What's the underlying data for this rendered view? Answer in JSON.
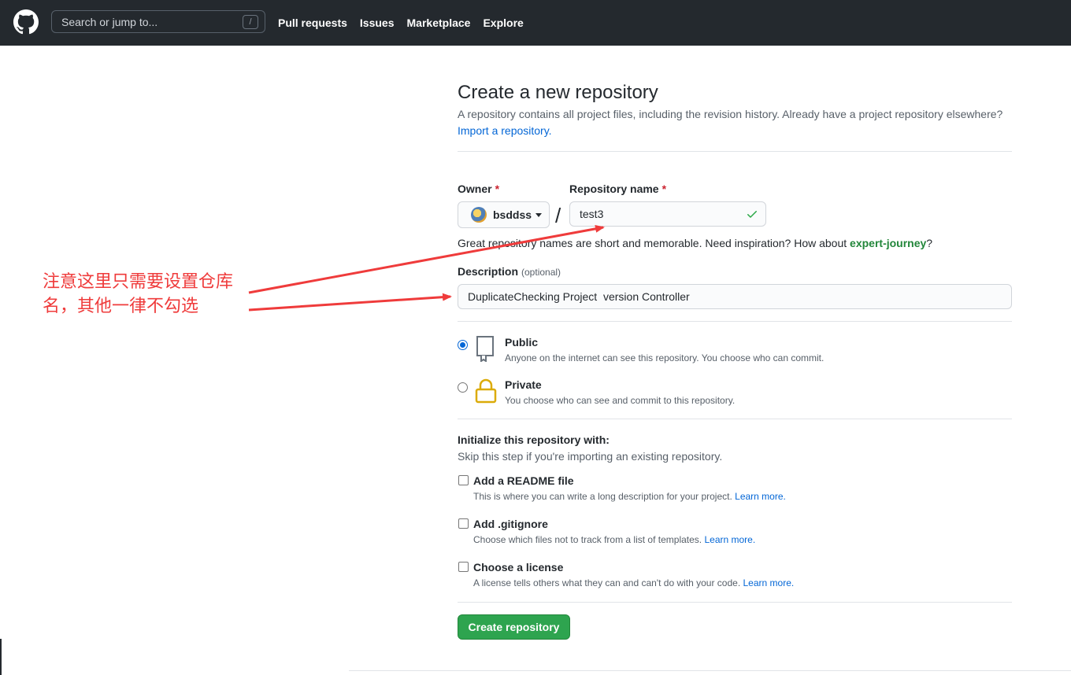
{
  "header": {
    "search_placeholder": "Search or jump to...",
    "search_key": "/",
    "nav": [
      "Pull requests",
      "Issues",
      "Marketplace",
      "Explore"
    ]
  },
  "page": {
    "title": "Create a new repository",
    "subtitle": "A repository contains all project files, including the revision history. Already have a project repository elsewhere?",
    "import_link": "Import a repository."
  },
  "form": {
    "owner_label": "Owner",
    "owner_value": "bsddss",
    "repo_label": "Repository name",
    "required_mark": "*",
    "separator": "/",
    "repo_value": "test3",
    "hint_prefix": "Great repository names are short and memorable. Need inspiration? How about ",
    "hint_suggestion": "expert-journey",
    "hint_suffix": "?",
    "desc_label": "Description",
    "desc_optional": "(optional)",
    "desc_value": "DuplicateChecking Project  version Controller"
  },
  "visibility": {
    "public_title": "Public",
    "public_desc": "Anyone on the internet can see this repository. You choose who can commit.",
    "private_title": "Private",
    "private_desc": "You choose who can see and commit to this repository.",
    "selected": "public"
  },
  "init": {
    "title": "Initialize this repository with:",
    "subtitle": "Skip this step if you're importing an existing repository.",
    "learn_more": "Learn more.",
    "items": [
      {
        "title": "Add a README file",
        "desc": "This is where you can write a long description for your project. "
      },
      {
        "title": "Add .gitignore",
        "desc": "Choose which files not to track from a list of templates. "
      },
      {
        "title": "Choose a license",
        "desc": "A license tells others what they can and can't do with your code. "
      }
    ]
  },
  "create_button": "Create repository",
  "annotation": {
    "line1": "注意这里只需要设置仓库",
    "line2": "名，其他一律不勾选",
    "color": "#ef3b3b"
  }
}
